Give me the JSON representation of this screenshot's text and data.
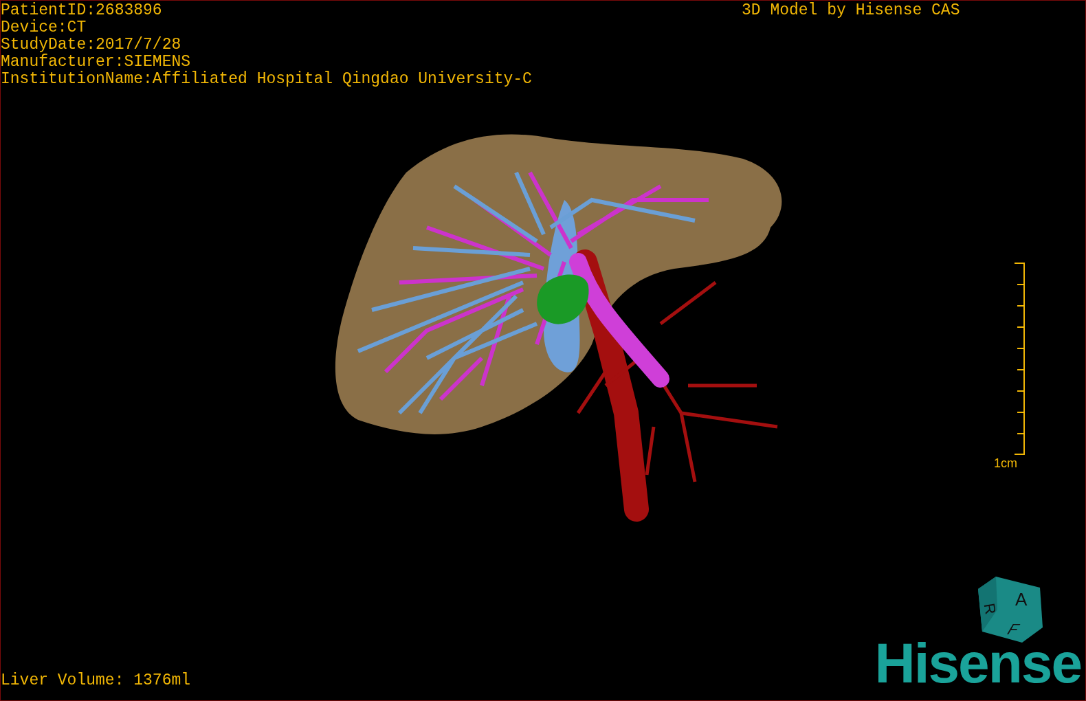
{
  "info_lines": [
    "PatientID:2683896",
    "Device:CT",
    "StudyDate:2017/7/28",
    "Manufacturer:SIEMENS",
    "InstitutionName:Affiliated Hospital Qingdao University-C"
  ],
  "title": "3D Model by Hisense CAS",
  "scale_bar": {
    "label": "1cm"
  },
  "orientation_cube": {
    "faces": [
      "R",
      "A",
      "F"
    ]
  },
  "liver_volume": "Liver Volume: 1376ml",
  "logo": "Hisense"
}
